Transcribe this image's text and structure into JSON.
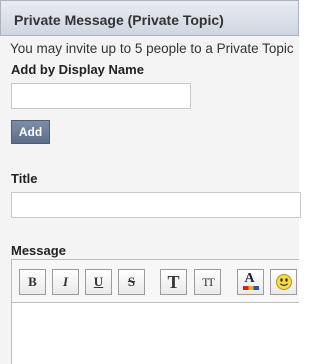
{
  "header": {
    "title": "Private Message (Private Topic)"
  },
  "intro_text": "You may invite up to 5 people to a Private Topic",
  "add_section": {
    "label": "Add by Display Name",
    "name_value": "",
    "add_button_label": "Add"
  },
  "title_section": {
    "label": "Title",
    "value": ""
  },
  "message_section": {
    "label": "Message"
  },
  "toolbar": {
    "bold": "B",
    "italic": "I",
    "underline": "U",
    "strike": "S",
    "font_size_large": "T",
    "font_size_small": "TT",
    "font_color": "A"
  },
  "icons": {
    "font_color": "font-color-icon",
    "emoticon": "smiley-icon"
  }
}
